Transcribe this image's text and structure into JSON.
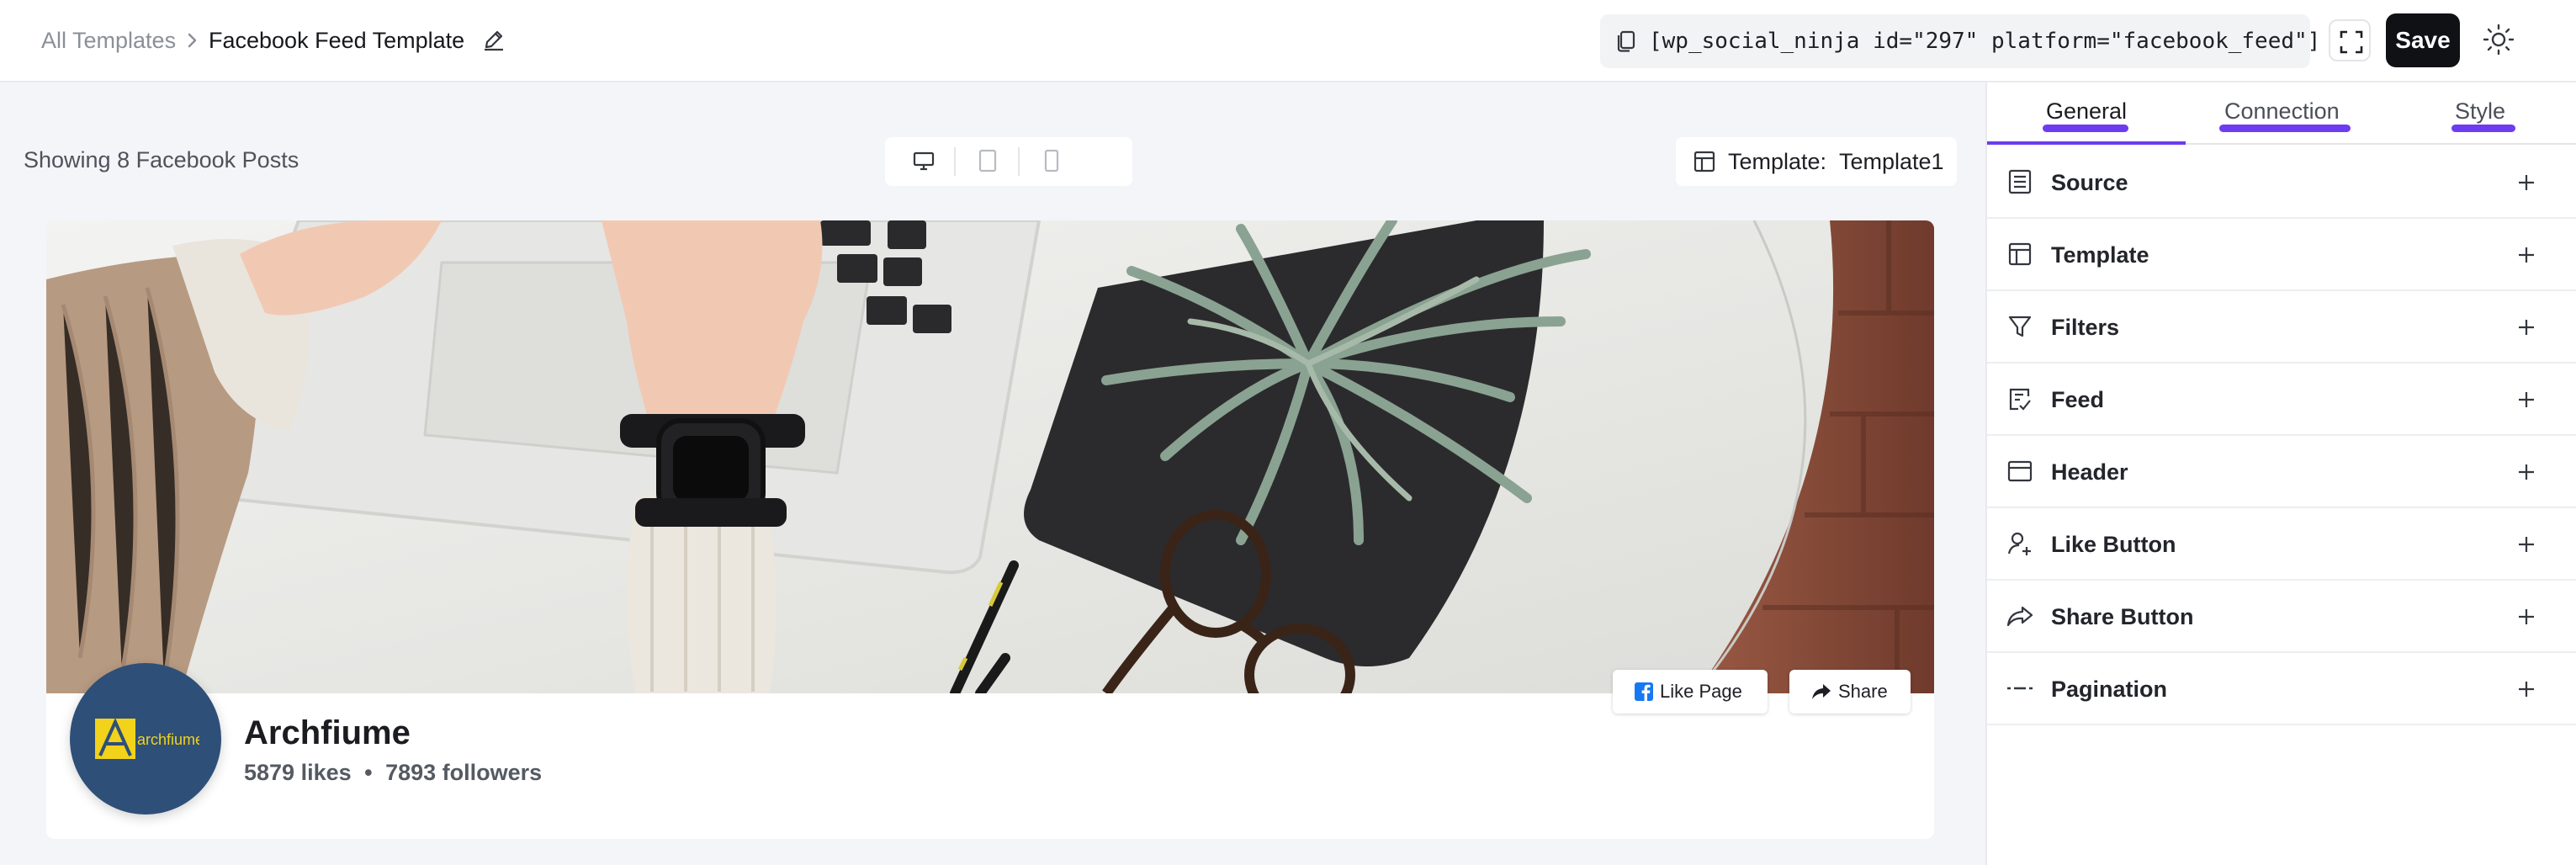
{
  "breadcrumb": {
    "root": "All Templates",
    "current": "Facebook Feed Template"
  },
  "toolbar": {
    "shortcode": "[wp_social_ninja id=\"297\" platform=\"facebook_feed\"]",
    "save_label": "Save"
  },
  "preview": {
    "showing_text": "Showing 8 Facebook Posts",
    "template_label": "Template:",
    "template_value": "Template1"
  },
  "page": {
    "name": "Archfiume",
    "likes": "5879 likes",
    "separator": "•",
    "followers": "7893 followers",
    "logo_text": "archfiume",
    "like_page_label": "Like Page",
    "share_label": "Share"
  },
  "sidebar": {
    "tabs": [
      {
        "label": "General",
        "active": true
      },
      {
        "label": "Connection",
        "active": false
      },
      {
        "label": "Style",
        "active": false
      }
    ],
    "sections": [
      {
        "label": "Source",
        "icon": "list-icon"
      },
      {
        "label": "Template",
        "icon": "layout-icon"
      },
      {
        "label": "Filters",
        "icon": "filter-icon"
      },
      {
        "label": "Feed",
        "icon": "checklist-icon"
      },
      {
        "label": "Header",
        "icon": "header-layout-icon"
      },
      {
        "label": "Like Button",
        "icon": "user-plus-icon"
      },
      {
        "label": "Share Button",
        "icon": "share-arrow-icon"
      },
      {
        "label": "Pagination",
        "icon": "pagination-icon"
      }
    ]
  },
  "colors": {
    "accent": "#6d3cf0",
    "save_bg": "#0f1115",
    "avatar_bg": "#2e4f78",
    "logo_yellow": "#f2d21b"
  }
}
